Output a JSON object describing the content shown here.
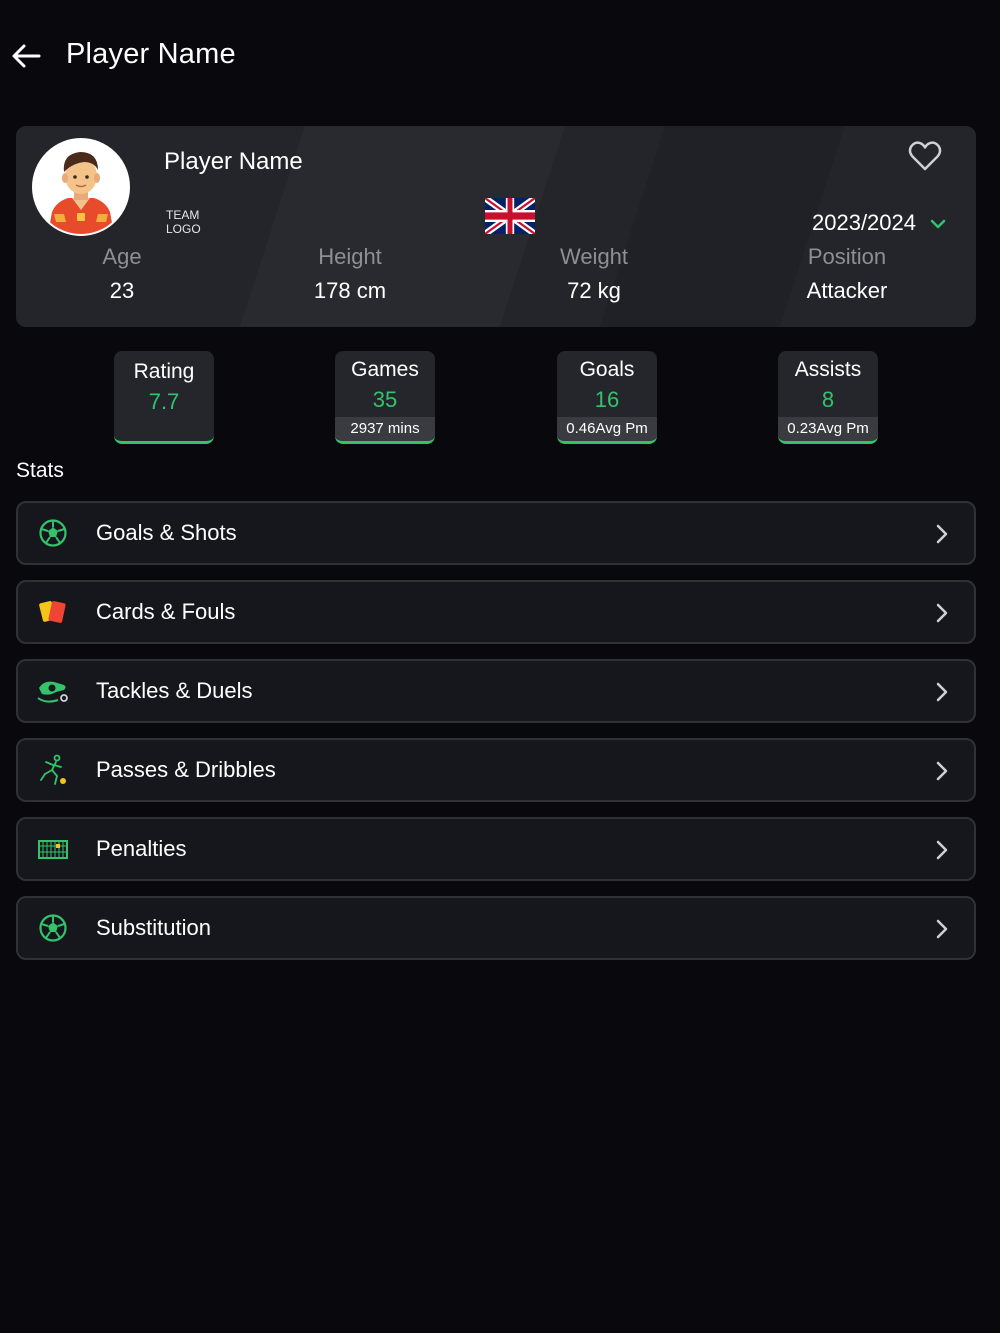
{
  "header": {
    "title": "Player Name"
  },
  "player": {
    "name": "Player Name",
    "team_logo_line1": "TEAM",
    "team_logo_line2": "LOGO",
    "season": "2023/2024",
    "info": [
      {
        "label": "Age",
        "value": "23"
      },
      {
        "label": "Height",
        "value": "178 cm"
      },
      {
        "label": "Weight",
        "value": "72 kg"
      },
      {
        "label": "Position",
        "value": "Attacker"
      }
    ]
  },
  "summary": [
    {
      "label": "Rating",
      "value": "7.7",
      "sub": ""
    },
    {
      "label": "Games",
      "value": "35",
      "sub": "2937 mins"
    },
    {
      "label": "Goals",
      "value": "16",
      "sub": "0.46Avg Pm"
    },
    {
      "label": "Assists",
      "value": "8",
      "sub": "0.23Avg Pm"
    }
  ],
  "stats": {
    "heading": "Stats",
    "items": [
      {
        "label": "Goals & Shots",
        "icon": "soccer-ball-icon"
      },
      {
        "label": "Cards & Fouls",
        "icon": "cards-icon"
      },
      {
        "label": "Tackles & Duels",
        "icon": "tackle-icon"
      },
      {
        "label": "Passes & Dribbles",
        "icon": "dribble-icon"
      },
      {
        "label": "Penalties",
        "icon": "goal-net-icon"
      },
      {
        "label": "Substitution",
        "icon": "soccer-ball-icon"
      }
    ]
  },
  "colors": {
    "background": "#08080d",
    "card": "#24252b",
    "accent_green": "#34c36b",
    "row_bg": "#16171c",
    "row_border": "#303137",
    "muted_text": "#8e8f95"
  }
}
